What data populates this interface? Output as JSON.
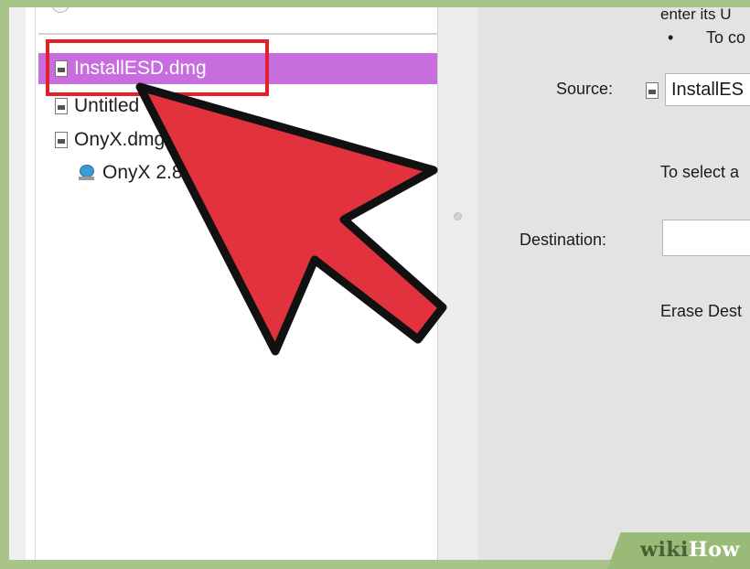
{
  "sidebar": {
    "items": [
      {
        "label": "InstallESD.dmg",
        "icon": "disk-image-file-icon",
        "selected": true
      },
      {
        "label": "Untitled",
        "icon": "disk-image-file-icon",
        "selected": false
      },
      {
        "label": "OnyX.dmg",
        "icon": "disk-image-file-icon",
        "selected": false
      },
      {
        "label": "OnyX 2.8",
        "icon": "mounted-volume-icon",
        "selected": false
      }
    ]
  },
  "panel": {
    "instruction_top": "enter its U",
    "instruction_bullet": "•",
    "instruction_line2": "To co",
    "source_label": "Source:",
    "source_value": "InstallES",
    "select_hint": "To select a",
    "destination_label": "Destination:",
    "destination_value": "",
    "erase_label": "Erase Dest"
  },
  "watermark": {
    "prefix": "wiki",
    "suffix": "How"
  },
  "colors": {
    "selection": "#c86ddd",
    "highlight_box": "#e0212a",
    "arrow_fill": "#e2323e",
    "frame_border": "#a9c48a"
  }
}
